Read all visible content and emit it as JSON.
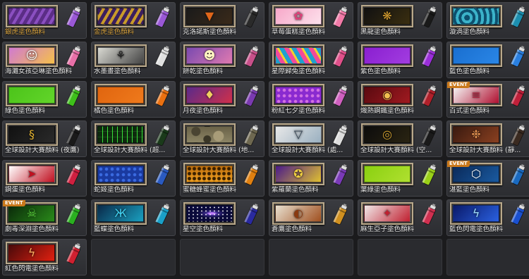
{
  "event_badge": "EVENT",
  "items": [
    {
      "label": "銀虎塗色顏料",
      "gold": true,
      "event": false,
      "colors": [
        "#5b2d86",
        "#8a4fc0"
      ],
      "pattern": "stripes",
      "can": "#9a58d6",
      "icon": "tiger-stripes-icon"
    },
    {
      "label": "金虎塗色顏料",
      "gold": true,
      "event": false,
      "colors": [
        "#3b1f5e",
        "#c89a2a"
      ],
      "pattern": "stripes",
      "can": "#9a58d6",
      "icon": "tiger-stripes-icon"
    },
    {
      "label": "克洛諾斯塗色顏料",
      "gold": false,
      "event": false,
      "colors": [
        "#1a1a1a",
        "#3a2a1a"
      ],
      "pattern": "solid",
      "can": "#2a2a2a",
      "icon": "chevron-icon",
      "glyph": "▼",
      "glyphColor": "#e0661a"
    },
    {
      "label": "草莓蛋糕塗色顏料",
      "gold": false,
      "event": false,
      "colors": [
        "#f7a8c9",
        "#fde1ec"
      ],
      "pattern": "solid",
      "can": "#f27aa8",
      "icon": "bunny-icon",
      "glyph": "✿",
      "glyphColor": "#e0407a"
    },
    {
      "label": "黑龍塗色顏料",
      "gold": false,
      "event": false,
      "colors": [
        "#111111",
        "#3a2e10"
      ],
      "pattern": "solid",
      "can": "#1a1a1a",
      "icon": "dragon-icon",
      "glyph": "❋",
      "glyphColor": "#d8a030"
    },
    {
      "label": "漩渦塗色顏料",
      "gold": false,
      "event": false,
      "colors": [
        "#0d4f6e",
        "#3bb2c9"
      ],
      "pattern": "waves",
      "can": "#1c8fb0",
      "icon": "wave-icon"
    },
    {
      "label": "海灘女孩亞琳塗色顏料",
      "gold": false,
      "event": false,
      "colors": [
        "#d07ad0",
        "#f5c04a"
      ],
      "pattern": "solid",
      "can": "#e870a8",
      "icon": "girl-icon",
      "glyph": "☺",
      "glyphColor": "#ffffff"
    },
    {
      "label": "水墨畫塗色顏料",
      "gold": false,
      "event": false,
      "colors": [
        "#d9d9d2",
        "#444444"
      ],
      "pattern": "solid",
      "can": "#e0e0e0",
      "icon": "ink-tree-icon",
      "glyph": "⚘",
      "glyphColor": "#222222"
    },
    {
      "label": "餅乾塗色顏料",
      "gold": false,
      "event": false,
      "colors": [
        "#7a4ab0",
        "#e07ab0"
      ],
      "pattern": "solid",
      "can": "#c8508a",
      "icon": "cookie-icon",
      "glyph": "☻",
      "glyphColor": "#fff3c0"
    },
    {
      "label": "星際歸兔塗色顏料",
      "gold": false,
      "event": false,
      "colors": [
        "#1fa0d0",
        "#f24a9a"
      ],
      "pattern": "stripes2",
      "can": "#e0508a",
      "icon": "space-bunny-icon"
    },
    {
      "label": "紫色塗色顏料",
      "gold": false,
      "event": false,
      "colors": [
        "#8a1fd0",
        "#a23de0"
      ],
      "pattern": "solid",
      "can": "#9a2ed8",
      "icon": ""
    },
    {
      "label": "藍色塗色顏料",
      "gold": false,
      "event": false,
      "colors": [
        "#1a6fd0",
        "#2a86e6"
      ],
      "pattern": "solid",
      "can": "#2a80e0",
      "icon": ""
    },
    {
      "label": "綠色塗色顏料",
      "gold": false,
      "event": false,
      "colors": [
        "#4cc41a",
        "#62d52a"
      ],
      "pattern": "solid",
      "can": "#3ec01a",
      "icon": ""
    },
    {
      "label": "橘色塗色顏料",
      "gold": false,
      "event": false,
      "colors": [
        "#e0650f",
        "#ef7a1c"
      ],
      "pattern": "solid",
      "can": "#ea7010",
      "icon": ""
    },
    {
      "label": "月夜塗色顏料",
      "gold": false,
      "event": false,
      "colors": [
        "#5a2a8a",
        "#d0304a"
      ],
      "pattern": "solid",
      "can": "#7a3ab0",
      "icon": "moon-wings-icon",
      "glyph": "♦",
      "glyphColor": "#f0d060"
    },
    {
      "label": "粉紅七夕塗色顏料",
      "gold": false,
      "event": false,
      "colors": [
        "#8a2ad0",
        "#d070e0"
      ],
      "pattern": "dots",
      "can": "#d060c0",
      "icon": "heart-icon"
    },
    {
      "label": "熾熱鋼鐵塗色顏料",
      "gold": false,
      "event": false,
      "colors": [
        "#5a0a10",
        "#a01a20"
      ],
      "pattern": "solid",
      "can": "#b0202a",
      "icon": "steel-eye-icon",
      "glyph": "◉",
      "glyphColor": "#f0c050"
    },
    {
      "label": "百式塗色顏料",
      "gold": false,
      "event": true,
      "colors": [
        "#f4f4f4",
        "#b01030"
      ],
      "pattern": "solid",
      "can": "#c0203a",
      "icon": "stripe-icon",
      "glyph": "≡",
      "glyphColor": "#b01030"
    },
    {
      "label": "全球設計大賽顏料 (夜鷹)",
      "gold": false,
      "event": false,
      "colors": [
        "#111111",
        "#2a2a2a"
      ],
      "pattern": "solid",
      "can": "#1a1a1a",
      "icon": "hawk-icon",
      "glyph": "§",
      "glyphColor": "#e0b030"
    },
    {
      "label": "全球設計大賽顏料 (超...",
      "gold": false,
      "event": false,
      "colors": [
        "#0e2a0e",
        "#1a4a1a"
      ],
      "pattern": "circuit",
      "can": "#1a3a1a",
      "icon": "circuit-icon"
    },
    {
      "label": "全球設計大賽顏料 (地...",
      "gold": false,
      "event": false,
      "colors": [
        "#6a6248",
        "#8c8464"
      ],
      "pattern": "camo",
      "can": "#6e6850",
      "icon": "camo-icon"
    },
    {
      "label": "全球設計大賽顏料 (處...",
      "gold": false,
      "event": false,
      "colors": [
        "#e8e8e8",
        "#9ab0c0"
      ],
      "pattern": "solid",
      "can": "#dddddd",
      "icon": "triangle-icon",
      "glyph": "▽",
      "glyphColor": "#304050"
    },
    {
      "label": "全球設計大賽顏料 (空...",
      "gold": false,
      "event": false,
      "colors": [
        "#0c0c0c",
        "#2a2412"
      ],
      "pattern": "solid",
      "can": "#1a1a1a",
      "icon": "emblem-icon",
      "glyph": "◎",
      "glyphColor": "#d0a030"
    },
    {
      "label": "全球設計大賽顏料 (靜...",
      "gold": false,
      "event": false,
      "colors": [
        "#3a1a10",
        "#8a4020"
      ],
      "pattern": "solid",
      "can": "#3a2a20",
      "icon": "dragon-icon",
      "glyph": "❉",
      "glyphColor": "#e09050"
    },
    {
      "label": "鋼蛋塗色顏料",
      "gold": false,
      "event": false,
      "colors": [
        "#ffffff",
        "#c01020"
      ],
      "pattern": "solid",
      "can": "#d02040",
      "icon": "chevron-icon",
      "glyph": "➤",
      "glyphColor": "#c01020"
    },
    {
      "label": "蛇姬塗色顏料",
      "gold": false,
      "event": false,
      "colors": [
        "#1a3aa0",
        "#3a6ae0"
      ],
      "pattern": "dots",
      "can": "#2a5ac0",
      "icon": "snake-icon"
    },
    {
      "label": "蜜糖蜂蜜塗色顏料",
      "gold": false,
      "event": false,
      "colors": [
        "#c07010",
        "#f0a020"
      ],
      "pattern": "hex",
      "can": "#e08010",
      "icon": "honey-icon"
    },
    {
      "label": "紫羅蘭塗色顏料",
      "gold": false,
      "event": false,
      "colors": [
        "#4a1a8a",
        "#e0c030"
      ],
      "pattern": "solid",
      "can": "#7a3ab8",
      "icon": "violet-emblem-icon",
      "glyph": "✪",
      "glyphColor": "#f0d040"
    },
    {
      "label": "葉綠塗色顏料",
      "gold": false,
      "event": false,
      "colors": [
        "#8ad010",
        "#b0e030"
      ],
      "pattern": "solid",
      "can": "#9ad018",
      "icon": ""
    },
    {
      "label": "湛藍塗色顏料",
      "gold": false,
      "event": true,
      "colors": [
        "#0a2a5a",
        "#1a5aa0"
      ],
      "pattern": "solid",
      "can": "#1a6ac0",
      "icon": "acua-logo-icon",
      "glyph": "⬡",
      "glyphColor": "#ffffff"
    },
    {
      "label": "劇毒深淵塗色顏料",
      "gold": false,
      "event": true,
      "colors": [
        "#0a2a0a",
        "#2a8a1a"
      ],
      "pattern": "solid",
      "can": "#2ab020",
      "icon": "skull-icon",
      "glyph": "☠",
      "glyphColor": "#60e040"
    },
    {
      "label": "藍蝶塗色顏料",
      "gold": false,
      "event": false,
      "colors": [
        "#0a2a4a",
        "#1aa0c0"
      ],
      "pattern": "solid",
      "can": "#1aa0c8",
      "icon": "butterfly-icon",
      "glyph": "Ж",
      "glyphColor": "#40d0f0"
    },
    {
      "label": "星空塗色顏料",
      "gold": false,
      "event": false,
      "colors": [
        "#0a0a3a",
        "#3a2a8a"
      ],
      "pattern": "stars",
      "can": "#2a2aa0",
      "icon": "galaxy-icon"
    },
    {
      "label": "蒼鷹塗色顏料",
      "gold": false,
      "event": false,
      "colors": [
        "#e8e0d0",
        "#a05020"
      ],
      "pattern": "solid",
      "can": "#d09020",
      "icon": "eagle-icon",
      "glyph": "◐",
      "glyphColor": "#8a3a10"
    },
    {
      "label": "麻生亞子塗色顏料",
      "gold": false,
      "event": false,
      "colors": [
        "#f0e8e8",
        "#c02030"
      ],
      "pattern": "solid",
      "can": "#d03050",
      "icon": "wolf-icon",
      "glyph": "✦",
      "glyphColor": "#c02030"
    },
    {
      "label": "藍色閃電塗色顏料",
      "gold": false,
      "event": false,
      "colors": [
        "#0a1a6a",
        "#2a60e0"
      ],
      "pattern": "solid",
      "can": "#1a50d0",
      "icon": "lightning-icon",
      "glyph": "ϟ",
      "glyphColor": "#a0e0ff"
    },
    {
      "label": "紅色閃電塗色顏料",
      "gold": false,
      "event": false,
      "colors": [
        "#4a0a0a",
        "#e02010"
      ],
      "pattern": "solid",
      "can": "#d02030",
      "icon": "lightning-icon",
      "glyph": "ϟ",
      "glyphColor": "#ffb060"
    },
    {
      "label": "",
      "empty": true
    },
    {
      "label": "",
      "empty": true
    },
    {
      "label": "",
      "empty": true
    },
    {
      "label": "",
      "empty": true
    },
    {
      "label": "",
      "empty": true
    }
  ]
}
